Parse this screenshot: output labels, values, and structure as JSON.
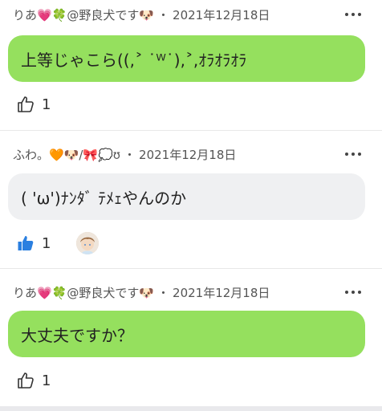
{
  "posts": [
    {
      "username": "りあ💗🍀@野良犬です🐶",
      "separator": "・",
      "date": "2021年12月18日",
      "message": "上等じゃこら((,˃ ˙ᵂ˙),˃,ｵﾗｵﾗｵﾗ",
      "bubble_color": "#95e05e",
      "likes": "1",
      "liked": false
    },
    {
      "username": "ふわ。🧡🐶/🎀💭ʊ",
      "separator": "・",
      "date": "2021年12月18日",
      "message": "( 'ω')ﾅﾝﾀﾞ ﾃﾒｪやんのか",
      "bubble_color": "#eff0f2",
      "likes": "1",
      "liked": true
    },
    {
      "username": "りあ💗🍀@野良犬です🐶",
      "separator": "・",
      "date": "2021年12月18日",
      "message": "大丈夫ですか？",
      "bubble_color": "#95e05e",
      "likes": "1",
      "liked": false
    }
  ],
  "colors": {
    "accent_like": "#2a7fe0",
    "green_bubble": "#95e05e",
    "gray_bubble": "#eff0f2"
  },
  "icons": {
    "more": "more-horizontal-icon",
    "like_outline": "thumbs-up-outline-icon",
    "like_filled": "thumbs-up-filled-icon"
  }
}
